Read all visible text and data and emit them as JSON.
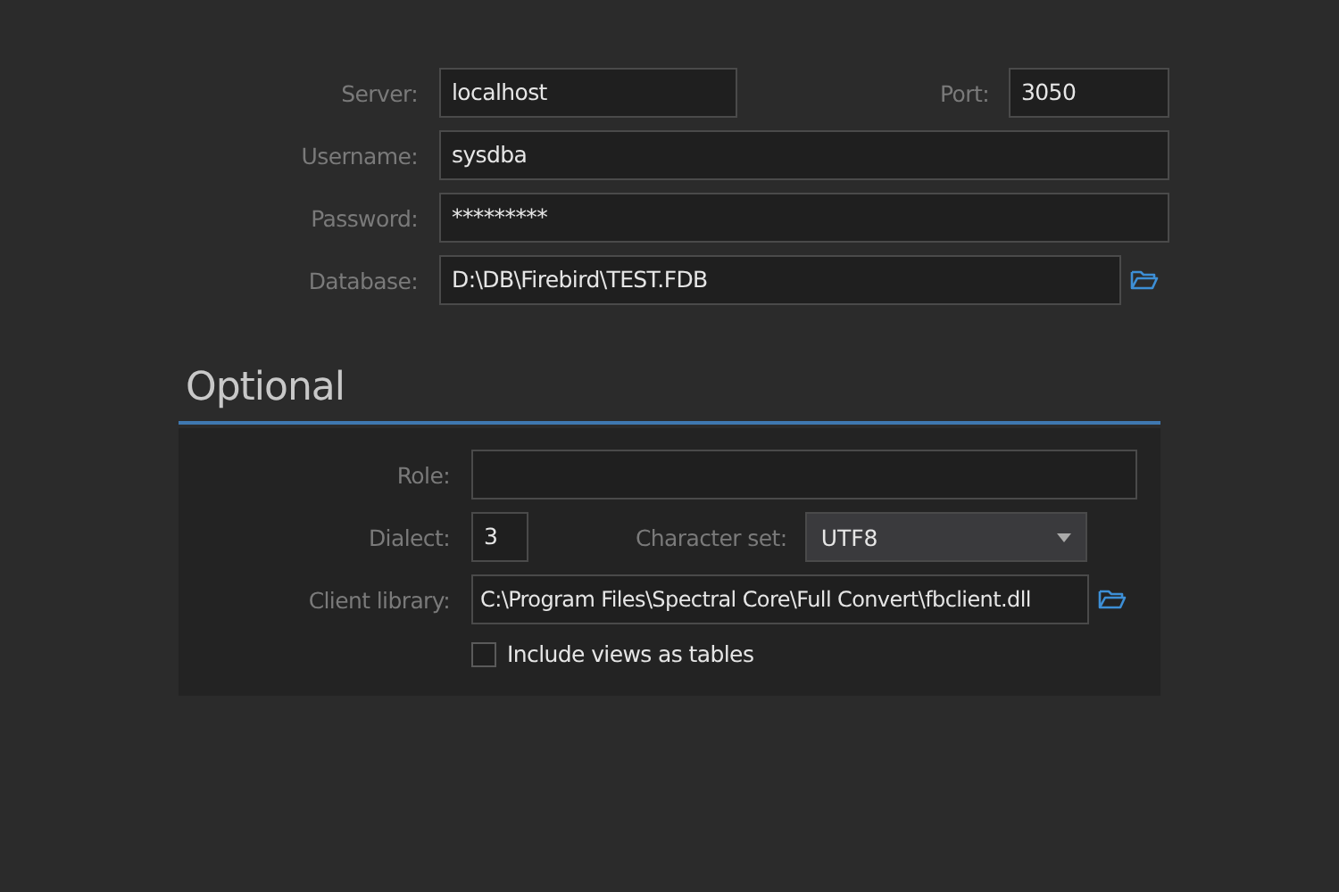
{
  "connection": {
    "server": {
      "label": "Server:",
      "value": "localhost"
    },
    "port": {
      "label": "Port:",
      "value": "3050"
    },
    "username": {
      "label": "Username:",
      "value": "sysdba"
    },
    "password": {
      "label": "Password:",
      "value": "*********"
    },
    "database": {
      "label": "Database:",
      "value": "D:\\DB\\Firebird\\TEST.FDB"
    }
  },
  "optional": {
    "title": "Optional",
    "role": {
      "label": "Role:"
    },
    "dialect": {
      "label": "Dialect:",
      "value": "3"
    },
    "character_set": {
      "label": "Character set:",
      "value": "UTF8"
    },
    "client_library": {
      "label": "Client library:",
      "value": "C:\\Program Files\\Spectral Core\\Full Convert\\fbclient.dll"
    },
    "include_views": {
      "label": "Include views as tables",
      "checked": false
    }
  }
}
